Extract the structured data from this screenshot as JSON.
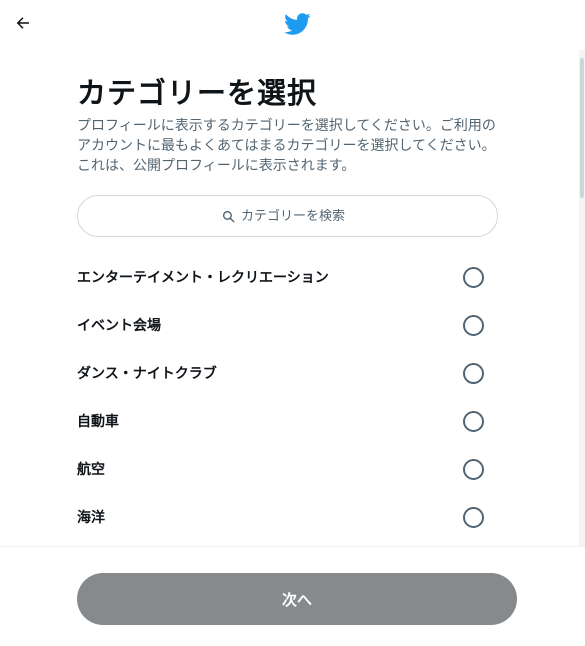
{
  "header": {
    "back_icon": "arrow-left-icon",
    "logo_icon": "twitter-bird-logo",
    "brand_color": "#1d9bf0"
  },
  "main": {
    "title": "カテゴリーを選択",
    "description": "プロフィールに表示するカテゴリーを選択してください。ご利用のアカウントに最もよくあてはまるカテゴリーを選択してください。これは、公開プロフィールに表示されます。",
    "search": {
      "icon": "search-icon",
      "placeholder": "カテゴリーを検索"
    },
    "categories": [
      {
        "label": "エンターテイメント・レクリエーション",
        "selected": false
      },
      {
        "label": "イベント会場",
        "selected": false
      },
      {
        "label": "ダンス・ナイトクラブ",
        "selected": false
      },
      {
        "label": "自動車",
        "selected": false
      },
      {
        "label": "航空",
        "selected": false
      },
      {
        "label": "海洋",
        "selected": false
      }
    ]
  },
  "footer": {
    "next_label": "次へ",
    "next_button_color": "#878a8c"
  }
}
